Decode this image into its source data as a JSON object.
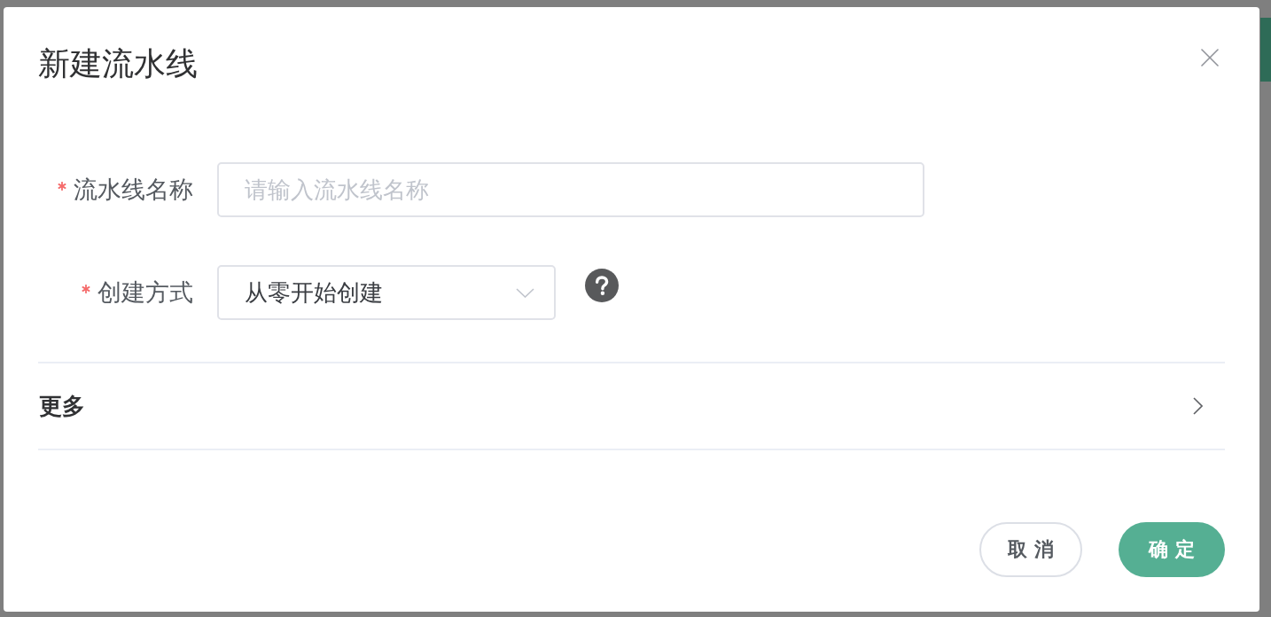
{
  "dialog": {
    "title": "新建流水线",
    "fields": [
      {
        "kind": "input",
        "label": "流水线名称",
        "required": true,
        "placeholder": "请输入流水线名称",
        "help": false
      },
      {
        "kind": "select",
        "label": "创建方式",
        "required": true,
        "value": "从零开始创建",
        "help": true
      }
    ],
    "more_section": {
      "label": "更多",
      "expanded": false
    },
    "buttons": [
      {
        "label": "取消",
        "kind": "secondary"
      },
      {
        "label": "确定",
        "kind": "primary"
      }
    ]
  }
}
